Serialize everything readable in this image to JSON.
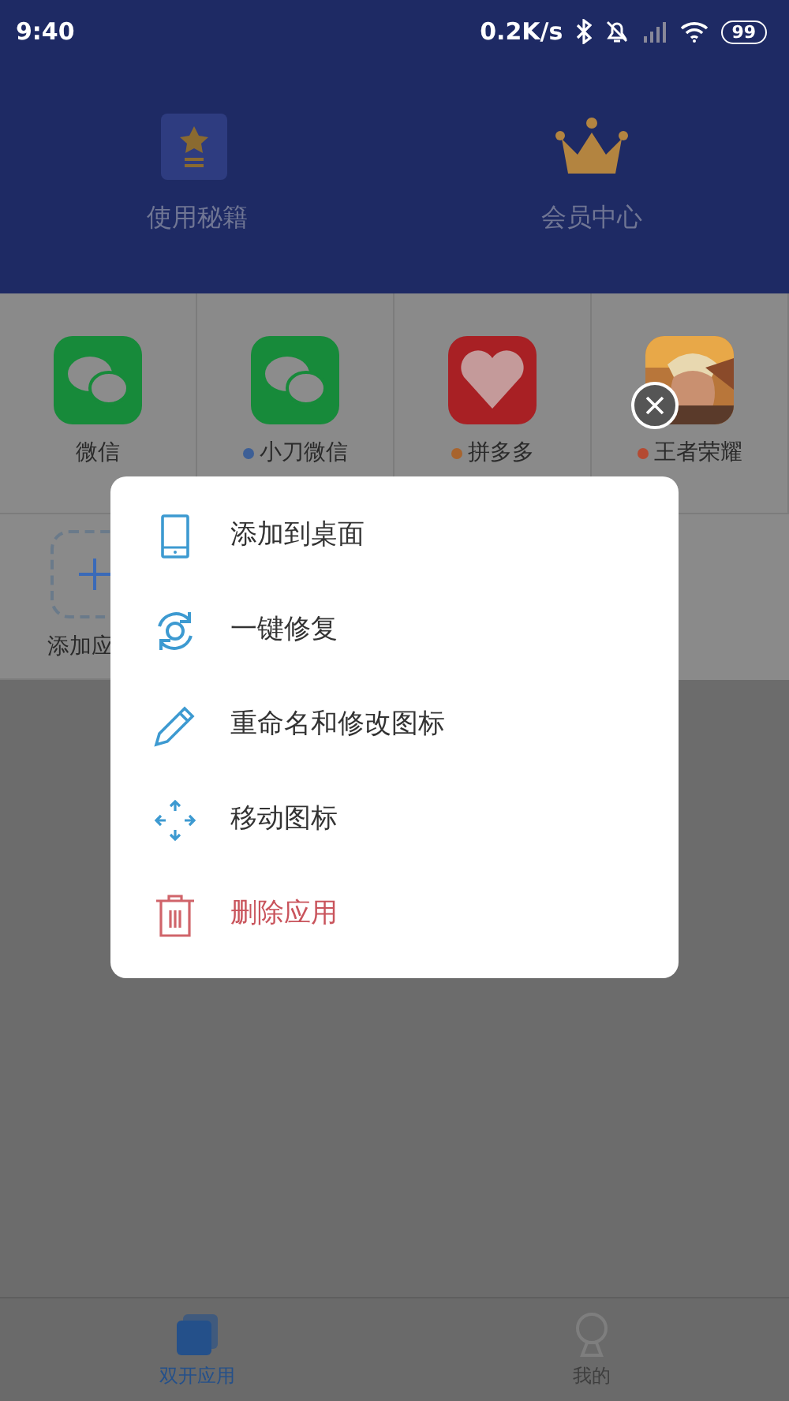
{
  "status_bar": {
    "time": "9:40",
    "speed": "0.2K/s",
    "battery": "99"
  },
  "header": {
    "items": [
      {
        "label": "使用秘籍",
        "kind": "guide"
      },
      {
        "label": "会员中心",
        "kind": "vip"
      }
    ]
  },
  "apps": [
    {
      "label": "微信",
      "kind": "chat"
    },
    {
      "label": "小刀微信",
      "kind": "chat",
      "color": "#3d5f96"
    },
    {
      "label": "拼多多",
      "kind": "shop",
      "color": "#a8642e"
    },
    {
      "label": "王者荣耀",
      "kind": "picture",
      "color": "#b44a32"
    },
    {
      "label": "添加应",
      "kind": "add"
    }
  ],
  "menu": {
    "items": [
      {
        "label": "添加到桌面",
        "kind": "phone",
        "danger": false
      },
      {
        "label": "一键修复",
        "kind": "repair",
        "danger": false
      },
      {
        "label": "重命名和修改图标",
        "kind": "pencil",
        "danger": false
      },
      {
        "label": "移动图标",
        "kind": "move",
        "danger": false
      },
      {
        "label": "删除应用",
        "kind": "trash",
        "danger": true
      }
    ]
  },
  "bottom_nav": [
    {
      "label": "双开应用",
      "kind": "apps",
      "selected": true
    },
    {
      "label": "我的",
      "kind": "me",
      "selected": false
    }
  ]
}
